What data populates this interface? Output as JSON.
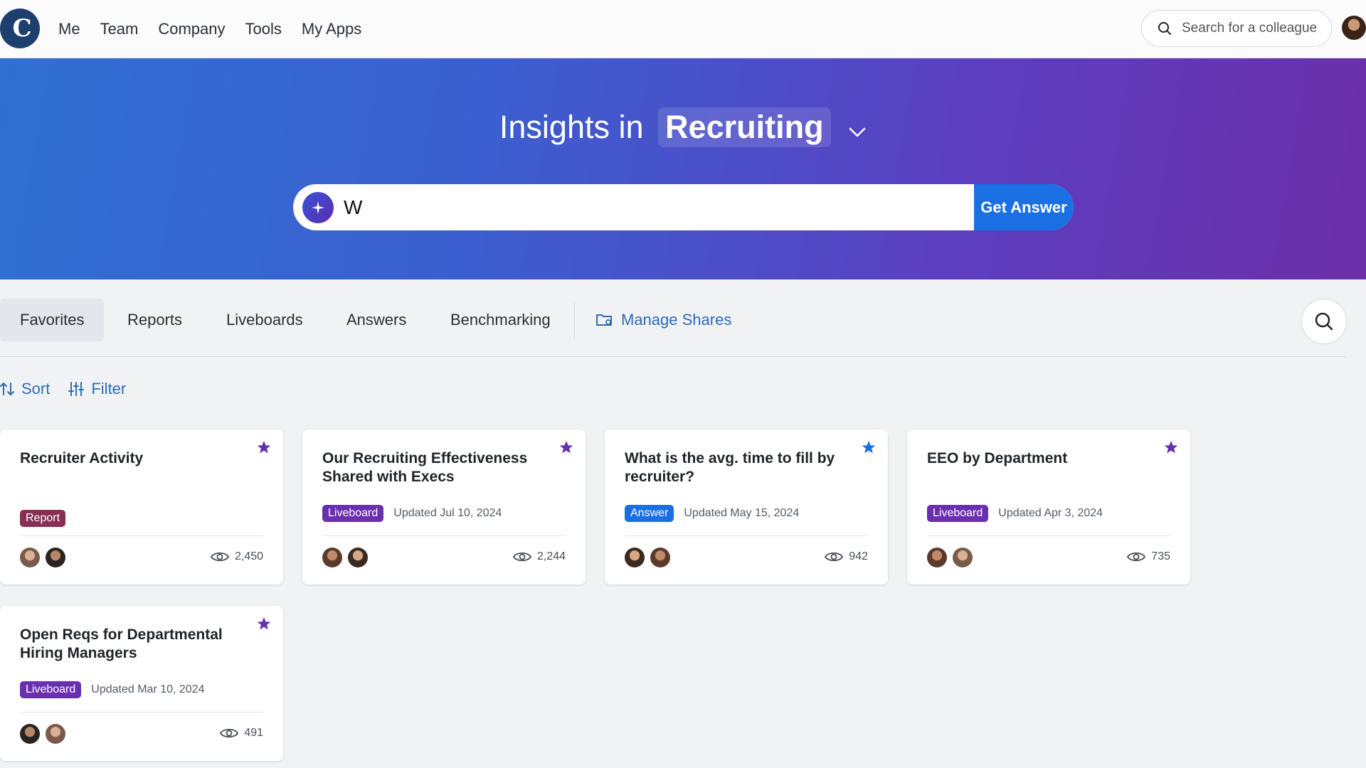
{
  "nav": {
    "logo_text": "C",
    "links": [
      "Me",
      "Team",
      "Company",
      "Tools",
      "My Apps"
    ],
    "search_placeholder": "Search for a colleague"
  },
  "hero": {
    "title_prefix": "Insights in",
    "title_topic": "Recruiting",
    "ask_value": "W",
    "get_answer_label": "Get Answer"
  },
  "tabs": {
    "items": [
      "Favorites",
      "Reports",
      "Liveboards",
      "Answers",
      "Benchmarking"
    ],
    "active": "Favorites",
    "manage_shares": "Manage Shares"
  },
  "toolbar": {
    "sort_label": "Sort",
    "filter_label": "Filter"
  },
  "cards": [
    {
      "title": "Recruiter Activity",
      "type": "Report",
      "updated": "",
      "views": "2,450",
      "star_color": "#6a2fae"
    },
    {
      "title": "Our Recruiting Effectiveness Shared with Execs",
      "type": "Liveboard",
      "updated": "Updated Jul 10, 2024",
      "views": "2,244",
      "star_color": "#6a2fae"
    },
    {
      "title": "What is the avg. time to fill by recruiter?",
      "type": "Answer",
      "updated": "Updated May 15, 2024",
      "views": "942",
      "star_color": "#1a6fe3"
    },
    {
      "title": "EEO by Department",
      "type": "Liveboard",
      "updated": "Updated Apr 3, 2024",
      "views": "735",
      "star_color": "#6a2fae"
    },
    {
      "title": "Open Reqs for Departmental Hiring Managers",
      "type": "Liveboard",
      "updated": "Updated Mar 10, 2024",
      "views": "491",
      "star_color": "#6a2fae"
    }
  ],
  "colors": {
    "accent": "#1a6fe3",
    "link": "#2b6cb8",
    "report_badge": "#8a2e54",
    "liveboard_badge": "#6a2fae"
  }
}
